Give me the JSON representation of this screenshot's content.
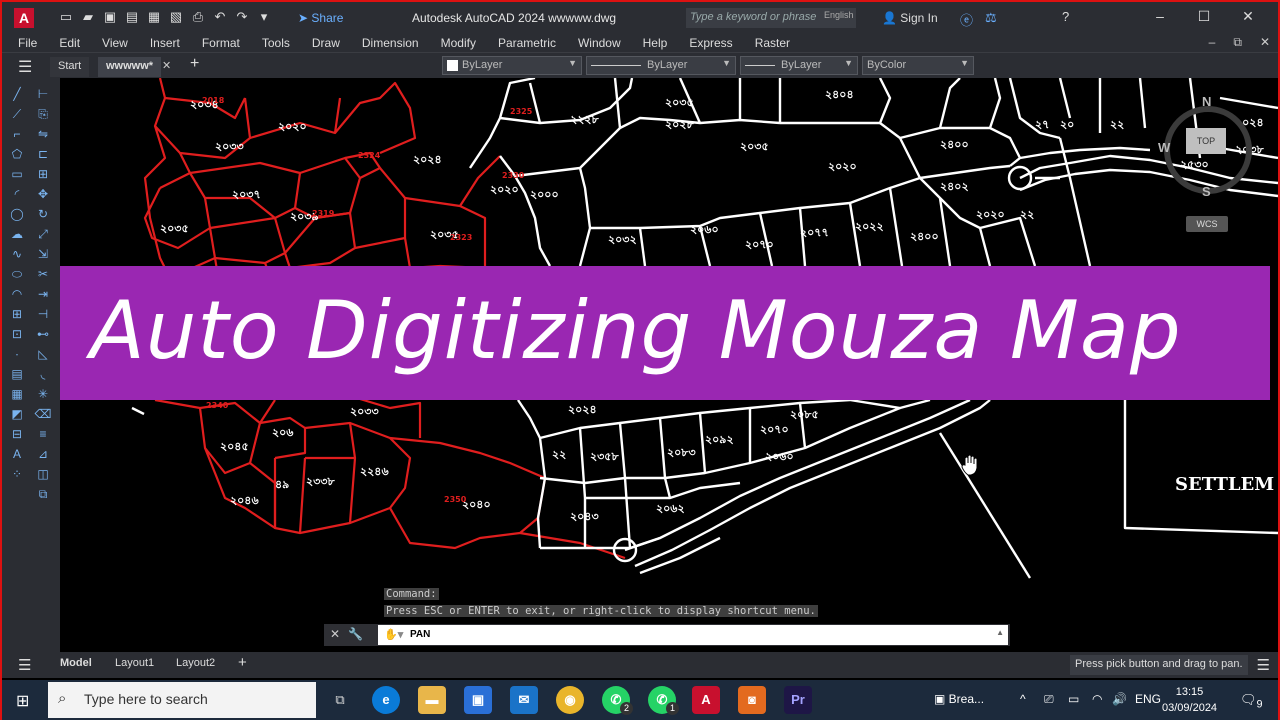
{
  "titlebar": {
    "app_logo": "A",
    "share": "Share",
    "title": "Autodesk AutoCAD 2024    wwwww.dwg",
    "search_placeholder": "Type a keyword or phrase",
    "language": "English",
    "signin": "Sign In"
  },
  "menu": [
    "File",
    "Edit",
    "View",
    "Insert",
    "Format",
    "Tools",
    "Draw",
    "Dimension",
    "Modify",
    "Parametric",
    "Window",
    "Help",
    "Express",
    "Raster"
  ],
  "tabs": {
    "start": "Start",
    "file": "wwwww*"
  },
  "properties": {
    "color": "ByLayer",
    "linetype": "ByLayer",
    "lineweight": "ByLayer",
    "plotstyle": "ByColor"
  },
  "viewcube": {
    "top": "TOP",
    "north": "N",
    "south": "S",
    "west": "W",
    "wcs": "WCS"
  },
  "canvas": {
    "settlement_label": "SETTLEM"
  },
  "banner": {
    "text": "Auto Digitizing Mouza Map",
    "color": "#9a27b2"
  },
  "command": {
    "history_1": "Command:",
    "history_2": "Press ESC or ENTER to exit, or right-click to display shortcut menu.",
    "current": "PAN"
  },
  "layout": {
    "model": "Model",
    "layout1": "Layout1",
    "layout2": "Layout2",
    "status_tip": "Press pick button and drag to pan."
  },
  "taskbar": {
    "search_placeholder": "Type here to search",
    "whatsapp_badge_1": "2",
    "whatsapp_badge_2": "1",
    "news": "Brea...",
    "language": "ENG",
    "time": "13:15",
    "date": "03/09/2024",
    "notifications": "9"
  },
  "colors": {
    "accent": "#9a27b2",
    "parcel_red": "#e01e1e",
    "parcel_white": "#ffffff",
    "ui_dark": "#2b2d33"
  }
}
